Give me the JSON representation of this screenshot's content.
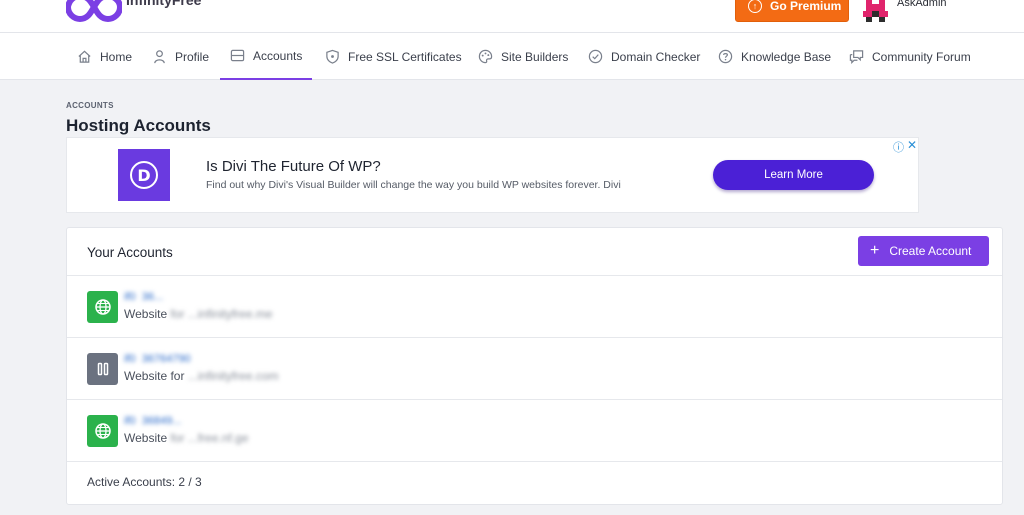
{
  "brand": {
    "name": "InfinityFree",
    "logo_color": "#7b3fe4"
  },
  "header": {
    "premium_label": "Go Premium",
    "premium_icon": "arrow-up-circle-icon",
    "username": "AskAdmin"
  },
  "nav": {
    "items": [
      {
        "label": "Home",
        "icon": "home-icon"
      },
      {
        "label": "Profile",
        "icon": "user-icon"
      },
      {
        "label": "Accounts",
        "icon": "server-icon",
        "active": true
      },
      {
        "label": "Free SSL Certificates",
        "icon": "shield-icon"
      },
      {
        "label": "Site Builders",
        "icon": "palette-icon"
      },
      {
        "label": "Domain Checker",
        "icon": "check-circle-icon"
      },
      {
        "label": "Knowledge Base",
        "icon": "question-circle-icon"
      },
      {
        "label": "Community Forum",
        "icon": "chat-icon"
      }
    ]
  },
  "page": {
    "breadcrumb": "ACCOUNTS",
    "title": "Hosting Accounts"
  },
  "ad": {
    "logo_letter": "D",
    "headline": "Is Divi The Future Of WP?",
    "description": "Find out why Divi's Visual Builder will change the way you build WP websites forever. Divi",
    "cta": "Learn More",
    "info_glyph": "ⓘ",
    "close_glyph": "✕"
  },
  "accounts": {
    "title": "Your Accounts",
    "create_label": "Create Account",
    "create_glyph": "+",
    "rows": [
      {
        "id": "if0_36...",
        "desc_prefix": "Website ",
        "desc_redacted": "for ...infinityfree.me",
        "status": "active",
        "icon": "globe-icon"
      },
      {
        "id": "if0_36764790",
        "desc_prefix": "Website for ",
        "desc_redacted": "...infinityfree.com",
        "status": "suspended",
        "icon": "pause-icon"
      },
      {
        "id": "if0_36849...",
        "desc_prefix": "Website ",
        "desc_redacted": "for ...free.nf.ge",
        "status": "active",
        "icon": "globe-icon"
      }
    ],
    "footer": "Active Accounts: 2 / 3"
  },
  "colors": {
    "accent": "#7b3fe4",
    "premium": "#f36b14",
    "active_status": "#2bb24c",
    "suspended_status": "#6b7280",
    "ad_cta": "#4b20d6"
  }
}
